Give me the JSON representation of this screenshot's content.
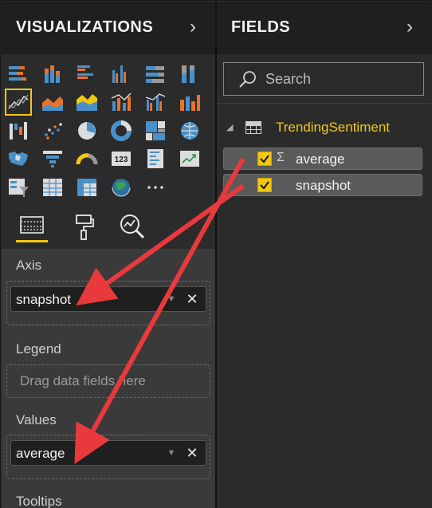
{
  "visualizations": {
    "title": "VISUALIZATIONS",
    "chevron": "›",
    "gallery": [
      "stacked-bar-chart-icon",
      "stacked-column-chart-icon",
      "clustered-bar-chart-icon",
      "clustered-column-chart-icon",
      "100-percent-stacked-bar-chart-icon",
      "100-percent-stacked-column-chart-icon",
      "line-chart-icon",
      "area-chart-icon",
      "stacked-area-chart-icon",
      "line-and-stacked-column-chart-icon",
      "line-and-clustered-column-chart-icon",
      "ribbon-chart-icon",
      "waterfall-chart-icon",
      "scatter-chart-icon",
      "pie-chart-icon",
      "donut-chart-icon",
      "treemap-icon",
      "map-icon",
      "filled-map-icon",
      "funnel-icon",
      "gauge-icon",
      "card-icon",
      "multi-row-card-icon",
      "kpi-icon",
      "slicer-icon",
      "table-icon",
      "matrix-icon",
      "globe-map-icon",
      "more-visuals-icon"
    ],
    "selected": "line-chart-icon",
    "tabs": [
      "fields-tab-icon",
      "format-paint-roller-icon",
      "analytics-magnifier-icon"
    ],
    "wells": {
      "axis": {
        "label": "Axis",
        "field": "snapshot"
      },
      "legend": {
        "label": "Legend",
        "placeholder": "Drag data fields here"
      },
      "values": {
        "label": "Values",
        "field": "average"
      },
      "tooltips": {
        "label": "Tooltips"
      }
    }
  },
  "fields": {
    "title": "FIELDS",
    "chevron": "›",
    "search_placeholder": "Search",
    "table": {
      "name": "TrendingSentiment",
      "expanded": true,
      "fields": [
        {
          "name": "average",
          "checked": true,
          "icon": "sigma-icon"
        },
        {
          "name": "snapshot",
          "checked": true,
          "icon": ""
        }
      ]
    }
  },
  "annotations": {
    "arrow_color": "#e8393c"
  },
  "colors": {
    "accent": "#f2c811",
    "header_bg": "#1f1f1f",
    "pane_bg": "#2b2b2b",
    "well_bg": "#3a3a3a"
  }
}
